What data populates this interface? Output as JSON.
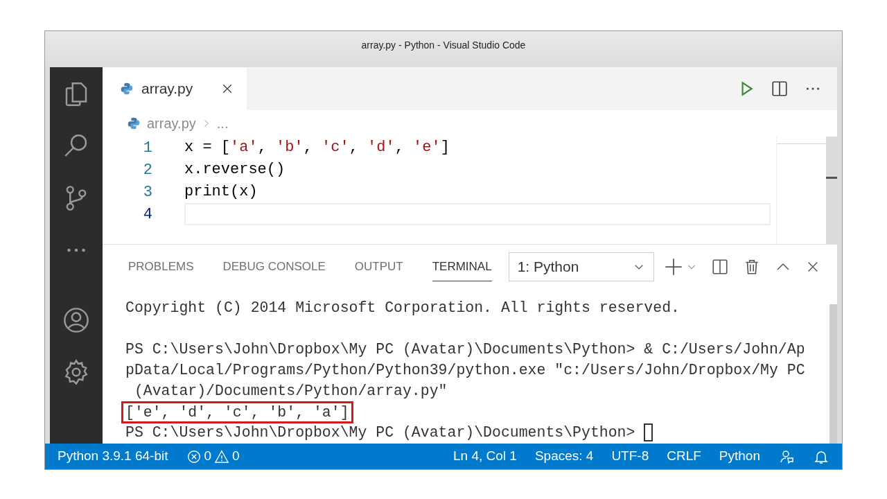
{
  "window": {
    "title": "array.py - Python - Visual Studio Code"
  },
  "tabs": [
    {
      "label": "array.py",
      "selected": true
    }
  ],
  "breadcrumb": {
    "file": "array.py",
    "more": "..."
  },
  "editor": {
    "lines": [
      {
        "number": "1",
        "current": false,
        "tokens": [
          {
            "text": "x = [",
            "kind": "plain"
          },
          {
            "text": "'a'",
            "kind": "string"
          },
          {
            "text": ", ",
            "kind": "plain"
          },
          {
            "text": "'b'",
            "kind": "string"
          },
          {
            "text": ", ",
            "kind": "plain"
          },
          {
            "text": "'c'",
            "kind": "string"
          },
          {
            "text": ", ",
            "kind": "plain"
          },
          {
            "text": "'d'",
            "kind": "string"
          },
          {
            "text": ", ",
            "kind": "plain"
          },
          {
            "text": "'e'",
            "kind": "string"
          },
          {
            "text": "]",
            "kind": "plain"
          }
        ]
      },
      {
        "number": "2",
        "current": false,
        "tokens": [
          {
            "text": "x.reverse()",
            "kind": "plain"
          }
        ]
      },
      {
        "number": "3",
        "current": false,
        "tokens": [
          {
            "text": "print(x)",
            "kind": "plain"
          }
        ]
      },
      {
        "number": "4",
        "current": true
      }
    ]
  },
  "panel": {
    "tabs": [
      {
        "label": "PROBLEMS",
        "selected": false
      },
      {
        "label": "DEBUG CONSOLE",
        "selected": false
      },
      {
        "label": "OUTPUT",
        "selected": false
      },
      {
        "label": "TERMINAL",
        "selected": true
      }
    ],
    "terminal_select": {
      "value": "1: Python"
    },
    "terminal": {
      "lines": [
        {
          "kind": "plain",
          "text": "Copyright (C) 2014 Microsoft Corporation. All rights reserved."
        },
        {
          "kind": "blank"
        },
        {
          "kind": "plain",
          "text": "PS C:\\Users\\John\\Dropbox\\My PC (Avatar)\\Documents\\Python> & C:/Users/John/Ap"
        },
        {
          "kind": "plain",
          "text": "pData/Local/Programs/Python/Python39/python.exe \"c:/Users/John/Dropbox/My PC"
        },
        {
          "kind": "plain",
          "text": " (Avatar)/Documents/Python/array.py\""
        },
        {
          "kind": "highlighted",
          "text": "['e', 'd', 'c', 'b', 'a']"
        },
        {
          "kind": "prompt",
          "text": "PS C:\\Users\\John\\Dropbox\\My PC (Avatar)\\Documents\\Python> "
        }
      ]
    }
  },
  "status_bar": {
    "interpreter": "Python 3.9.1 64-bit",
    "errors": "0",
    "warnings": "0",
    "position": "Ln 4, Col 1",
    "indentation": "Spaces: 4",
    "encoding": "UTF-8",
    "eol": "CRLF",
    "language": "Python"
  }
}
